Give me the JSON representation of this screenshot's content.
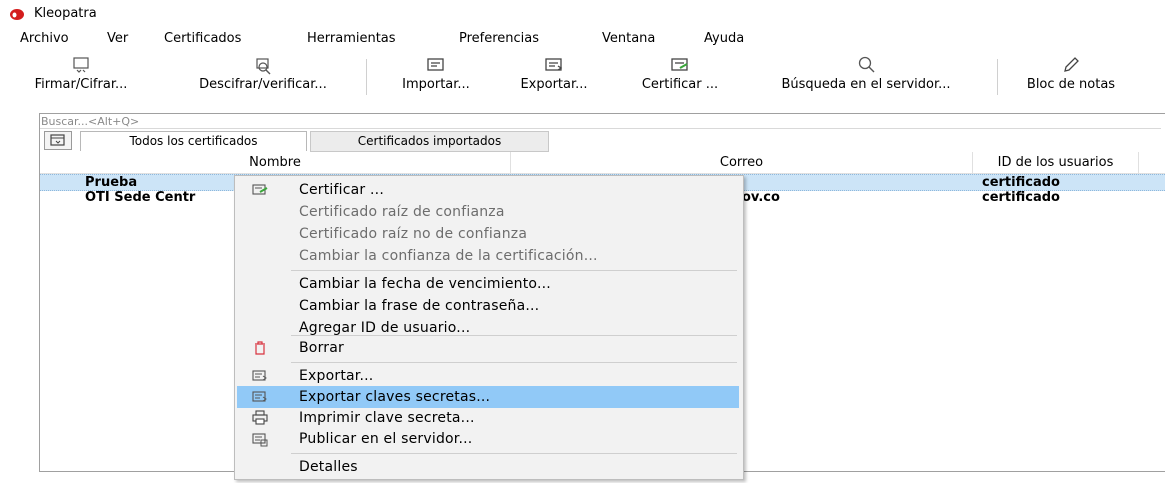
{
  "app": {
    "title": "Kleopatra"
  },
  "menubar": [
    "Archivo",
    "Ver",
    "Certificados",
    "Herramientas",
    "Preferencias",
    "Ventana",
    "Ayuda"
  ],
  "toolbar": {
    "sign_encrypt": "Firmar/Cifrar...",
    "decrypt_verify": "Descifrar/verificar...",
    "import": "Importar...",
    "export": "Exportar...",
    "certify": "Certificar ...",
    "lookup_server": "Búsqueda en el servidor...",
    "notepad": "Bloc de notas"
  },
  "search": {
    "placeholder": "Buscar...<Alt+Q>",
    "value": ""
  },
  "tabs": {
    "all": "Todos los certificados",
    "imported": "Certificados importados"
  },
  "table": {
    "headers": {
      "name": "Nombre",
      "email": "Correo",
      "userids": "ID de los usuarios"
    },
    "rows": [
      {
        "name": "Prueba",
        "email": "",
        "userids": "certificado",
        "selected": true
      },
      {
        "name": "OTI Sede Centr",
        "email": "ov.co",
        "userids": "certificado",
        "selected": false
      }
    ]
  },
  "context_menu": {
    "certify": "Certificar ...",
    "trust_root": "Certificado raíz de confianza",
    "distrust_root": "Certificado raíz no de confianza",
    "change_trust": "Cambiar la confianza de la certificación...",
    "change_expiry": "Cambiar la fecha de vencimiento...",
    "change_passphrase": "Cambiar la frase de contraseña...",
    "add_userid": "Agregar ID de usuario...",
    "delete": "Borrar",
    "export": "Exportar...",
    "export_secret": "Exportar claves secretas...",
    "print_secret": "Imprimir clave secreta...",
    "publish": "Publicar en el servidor...",
    "details": "Detalles"
  },
  "colors": {
    "selection": "#cce4f7",
    "menu_highlight": "#91c9f7",
    "delete_icon": "#d9333f",
    "certify_icon": "#3aa63a"
  }
}
